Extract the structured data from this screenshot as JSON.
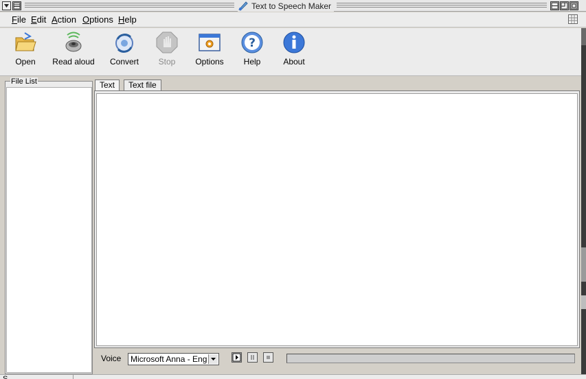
{
  "window": {
    "title": "Text to Speech Maker"
  },
  "menu": {
    "items": [
      {
        "label": "File",
        "accel": "F",
        "rest": "ile"
      },
      {
        "label": "Edit",
        "accel": "E",
        "rest": "dit"
      },
      {
        "label": "Action",
        "accel": "A",
        "rest": "ction"
      },
      {
        "label": "Options",
        "accel": "O",
        "rest": "ptions"
      },
      {
        "label": "Help",
        "accel": "H",
        "rest": "elp"
      }
    ]
  },
  "toolbar": {
    "items": [
      {
        "label": "Open",
        "icon": "folder-open-icon",
        "enabled": true
      },
      {
        "label": "Read aloud",
        "icon": "speaker-icon",
        "enabled": true
      },
      {
        "label": "Convert",
        "icon": "convert-icon",
        "enabled": true
      },
      {
        "label": "Stop",
        "icon": "stop-hand-icon",
        "enabled": false
      },
      {
        "label": "Options",
        "icon": "options-window-icon",
        "enabled": true
      },
      {
        "label": "Help",
        "icon": "help-question-icon",
        "enabled": true
      },
      {
        "label": "About",
        "icon": "info-icon",
        "enabled": true
      }
    ]
  },
  "file_list": {
    "legend": "File List"
  },
  "tabs": [
    {
      "label": "Text",
      "active": true
    },
    {
      "label": "Text file",
      "active": false
    }
  ],
  "editor": {
    "value": ""
  },
  "voice": {
    "label": "Voice",
    "selected": "Microsoft Anna - English"
  },
  "playback": {
    "progress": 0
  },
  "status": {
    "text": "S"
  },
  "colors": {
    "chrome": "#ececec",
    "accent": "#1e6fd0"
  }
}
